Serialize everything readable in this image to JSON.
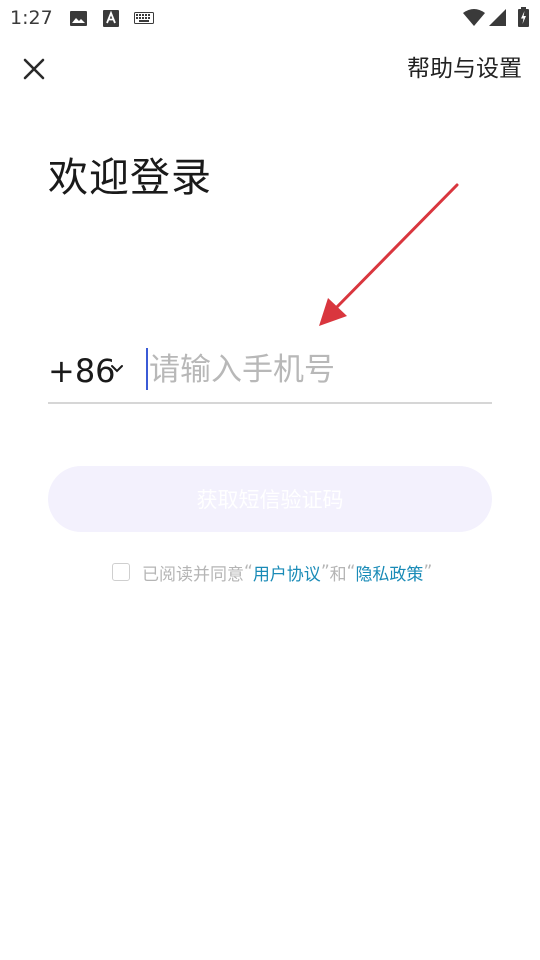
{
  "status_bar": {
    "time": "1:27",
    "icons": [
      "image-icon",
      "text-a-icon",
      "keyboard-icon",
      "wifi-icon",
      "signal-icon",
      "battery-charging-icon"
    ]
  },
  "header": {
    "close_icon": "close-icon",
    "help_label": "帮助与设置"
  },
  "login": {
    "title": "欢迎登录",
    "country_code": "+86",
    "phone_placeholder": "请输入手机号",
    "sms_button_label": "获取短信验证码"
  },
  "agreement": {
    "checked": false,
    "prefix": "已阅读并同意",
    "quote_open_1": "“",
    "user_agreement": "用户协议",
    "quote_close_1": "”",
    "conjunction": "和",
    "quote_open_2": "“",
    "privacy_policy": "隐私政策",
    "quote_close_2": "”"
  },
  "colors": {
    "accent_link": "#1a8bb7",
    "button_bg": "#f3f1fd",
    "cursor": "#3b5bd6",
    "annotation_arrow": "#d9363e"
  }
}
